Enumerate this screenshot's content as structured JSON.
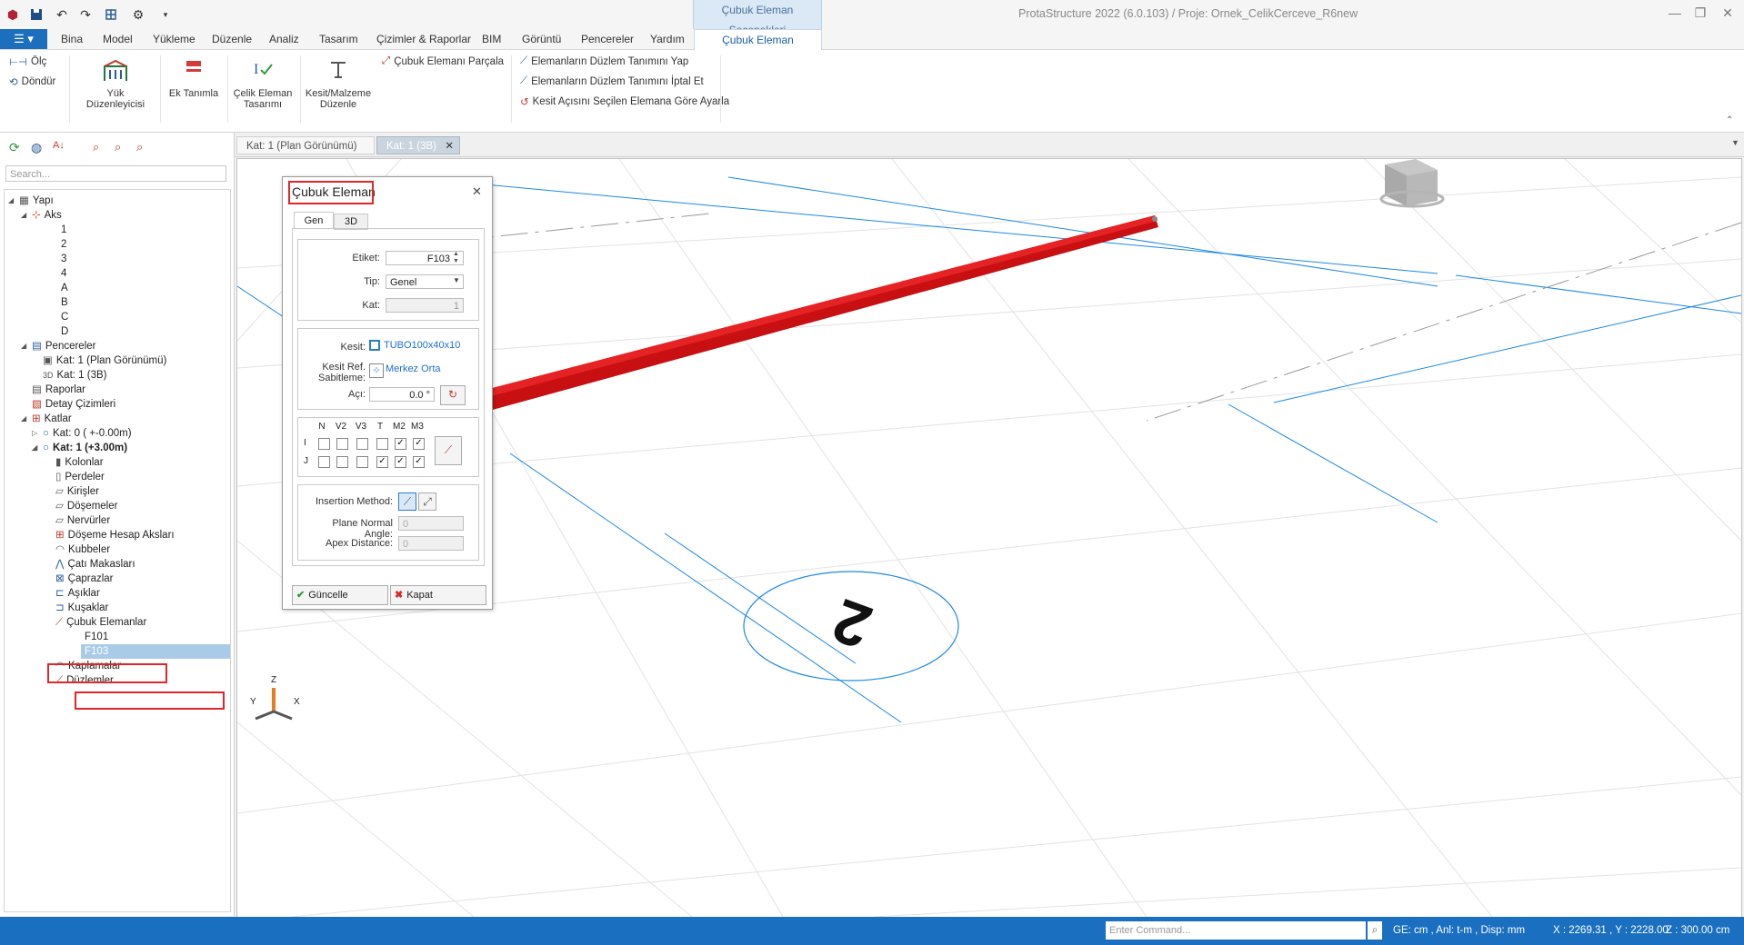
{
  "app": {
    "title": "ProtaStructure 2022 (6.0.103) / Proje: Ornek_CelikCerceve_R6new",
    "context_tab_group": "Çubuk Eleman Seçenekleri"
  },
  "ribbon_tabs": [
    "Bina",
    "Model",
    "Yükleme",
    "Düzenle",
    "Analiz",
    "Tasarım",
    "Çizimler & Raporlar",
    "BIM",
    "Görüntü",
    "Pencereler",
    "Yardım"
  ],
  "active_tab": "Çubuk Eleman",
  "ribbon": {
    "measure": "Ölç",
    "rotate": "Döndür",
    "load_editor": "Yük Düzenleyicisi",
    "add_def": "Ek Tanımla",
    "steel_design_1": "Çelik Eleman",
    "steel_design_2": "Tasarımı",
    "section_edit_1": "Kesit/Malzeme",
    "section_edit_2": "Düzenle",
    "split": "Çubuk Elemanı Parçala",
    "plane_def": "Elemanların Düzlem Tanımını Yap",
    "plane_cancel": "Elemanların Düzlem Tanımını İptal Et",
    "angle_adjust": "Kesit Açısını Seçilen Elemana Göre Ayarla"
  },
  "left": {
    "search_placeholder": "Search...",
    "tree": {
      "root": "Yapı",
      "aks": "Aks",
      "aks_items": [
        "1",
        "2",
        "3",
        "4",
        "A",
        "B",
        "C",
        "D"
      ],
      "windows": "Pencereler",
      "win1": "Kat: 1 (Plan Görünümü)",
      "win2": "Kat: 1 (3B)",
      "reports": "Raporlar",
      "details": "Detay Çizimleri",
      "floors": "Katlar",
      "floor0": "Kat: 0 ( +-0.00m)",
      "floor1": "Kat: 1 (+3.00m)",
      "members": [
        "Kolonlar",
        "Perdeler",
        "Kirişler",
        "Döşemeler",
        "Nervürler",
        "Döşeme Hesap Aksları",
        "Kubbeler",
        "Çatı Makasları",
        "Çaprazlar",
        "Aşıklar",
        "Kuşaklar",
        "Çubuk Elemanlar"
      ],
      "bar_items": [
        "F101",
        "F103"
      ],
      "after": [
        "Kaplamalar",
        "Düzlemler"
      ]
    }
  },
  "doc_tabs": [
    "Kat: 1 (Plan Görünümü)",
    "Kat: 1 (3B)"
  ],
  "dialog": {
    "title": "Çubuk Eleman",
    "tabs": [
      "Gen",
      "3D"
    ],
    "etiket_label": "Etiket:",
    "etiket": "F103",
    "tip_label": "Tip:",
    "tip": "Genel",
    "kat_label": "Kat:",
    "kat": "1",
    "kesit_label": "Kesit:",
    "kesit": "TUBO100x40x10",
    "ref_label_1": "Kesit Ref.",
    "ref_label_2": "Sabitleme:",
    "ref": "Merkez Orta",
    "aci_label": "Açı:",
    "aci": "0.0 °",
    "release_cols": [
      "N",
      "V2",
      "V3",
      "T",
      "M2",
      "M3"
    ],
    "release_rows": [
      "I",
      "J"
    ],
    "release_I": [
      false,
      false,
      false,
      false,
      true,
      true
    ],
    "release_J": [
      false,
      false,
      false,
      true,
      true,
      true
    ],
    "insertion_label": "Insertion Method:",
    "plane_normal_label": "Plane Normal Angle:",
    "plane_normal": "0",
    "apex_label": "Apex Distance:",
    "apex": "0",
    "update": "Güncelle",
    "close": "Kapat"
  },
  "viewport": {
    "axis_bubble": "2",
    "axis_x": "X",
    "axis_y": "Y",
    "axis_z": "Z"
  },
  "status": {
    "command_placeholder": "Enter Command...",
    "units": "GE: cm , Anl: t-m , Disp: mm",
    "coords": "X : 2269.31 , Y : 2228.00",
    "z": "Z : 300.00 cm"
  }
}
